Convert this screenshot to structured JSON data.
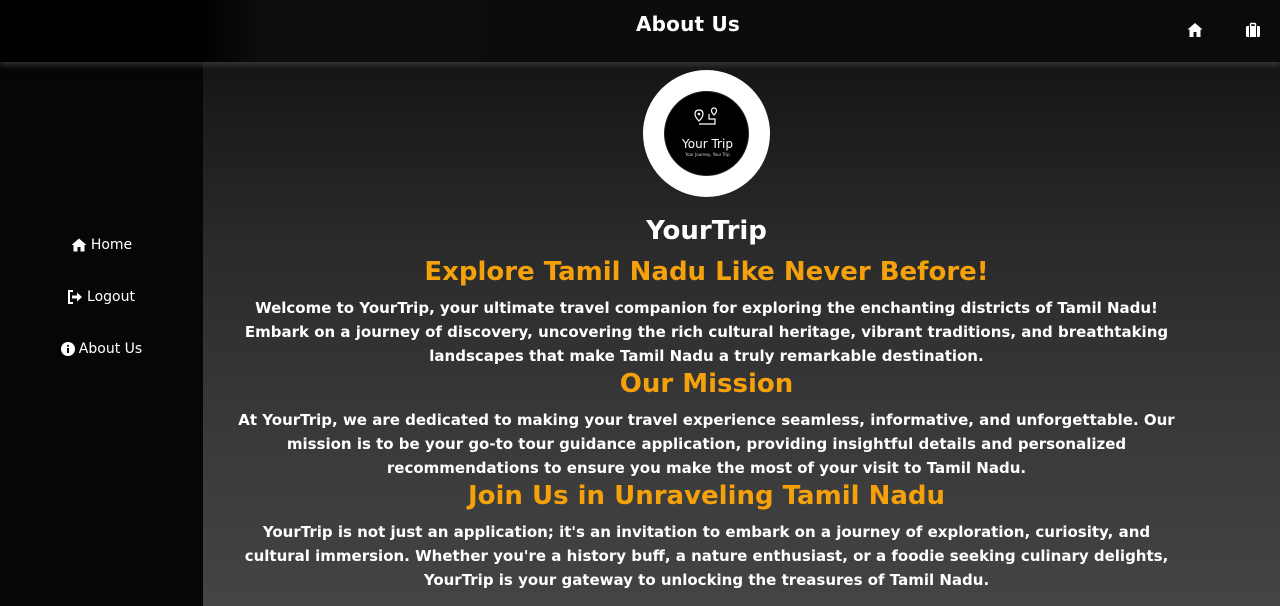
{
  "header": {
    "title": "About Us",
    "icons": [
      "home-icon",
      "briefcase-icon"
    ]
  },
  "sidebar": {
    "items": [
      {
        "label": "Home",
        "icon": "home-icon"
      },
      {
        "label": "Logout",
        "icon": "logout-icon"
      },
      {
        "label": "About Us",
        "icon": "info-icon"
      }
    ]
  },
  "logo": {
    "name": "Your Trip",
    "tagline": "Your Journey, Your Trip"
  },
  "main": {
    "brand": "YourTrip",
    "sections": [
      {
        "heading": "Explore Tamil Nadu Like Never Before!",
        "body": "Welcome to YourTrip, your ultimate travel companion for exploring the enchanting districts of Tamil Nadu! Embark on a journey of discovery, uncovering the rich cultural heritage, vibrant traditions, and breathtaking landscapes that make Tamil Nadu a truly remarkable destination."
      },
      {
        "heading": "Our Mission",
        "body": "At YourTrip, we are dedicated to making your travel experience seamless, informative, and unforgettable. Our mission is to be your go-to tour guidance application, providing insightful details and personalized recommendations to ensure you make the most of your visit to Tamil Nadu."
      },
      {
        "heading": "Join Us in Unraveling Tamil Nadu",
        "body": "YourTrip is not just an application; it's an invitation to embark on a journey of exploration, curiosity, and cultural immersion. Whether you're a history buff, a nature enthusiast, or a foodie seeking culinary delights, YourTrip is your gateway to unlocking the treasures of Tamil Nadu."
      }
    ]
  },
  "colors": {
    "accent": "#f5a10b",
    "text": "#ffffff",
    "sidebar": "#060606"
  }
}
